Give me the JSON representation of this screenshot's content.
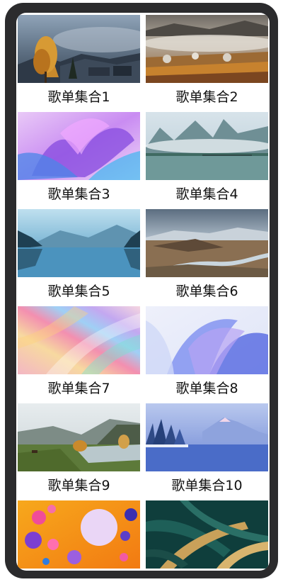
{
  "playlists": [
    {
      "title": "歌单集合1",
      "image": "autumn-village-mist"
    },
    {
      "title": "歌单集合2",
      "image": "foggy-forest-village"
    },
    {
      "title": "歌单集合3",
      "image": "purple-abstract-petals"
    },
    {
      "title": "歌单集合4",
      "image": "misty-lake-karst"
    },
    {
      "title": "歌单集合5",
      "image": "blue-lake-mountains"
    },
    {
      "title": "歌单集合6",
      "image": "river-valley-hills"
    },
    {
      "title": "歌单集合7",
      "image": "iridescent-feather"
    },
    {
      "title": "歌单集合8",
      "image": "blue-abstract-flower"
    },
    {
      "title": "歌单集合9",
      "image": "river-meadow-autumn"
    },
    {
      "title": "歌单集合10",
      "image": "frozen-lake-blue"
    },
    {
      "title": "",
      "image": "colorful-bubbles"
    },
    {
      "title": "",
      "image": "dark-palm-leaves"
    }
  ]
}
